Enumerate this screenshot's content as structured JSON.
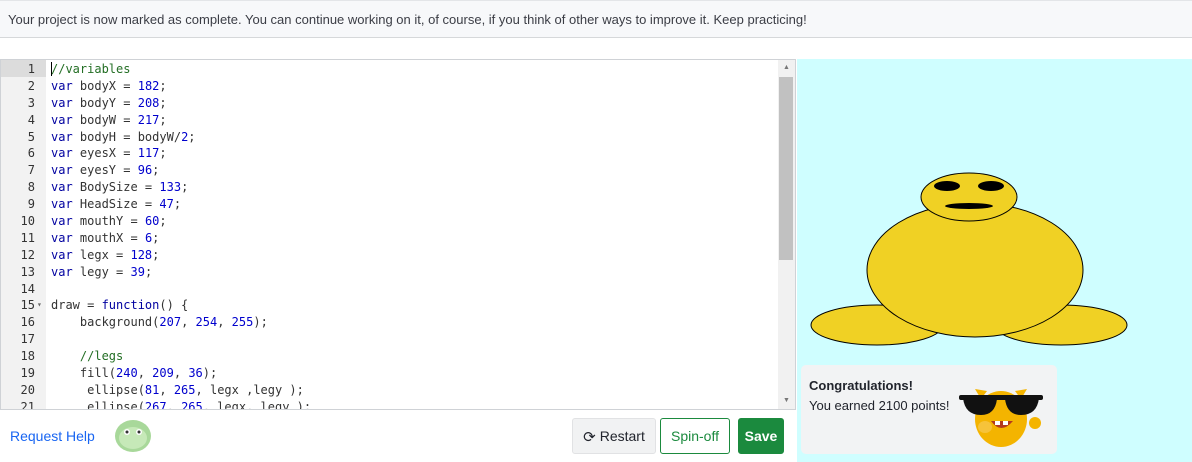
{
  "banner": {
    "message": "Your project is now marked as complete. You can continue working on it, of course, if you think of other ways to improve it. Keep practicing!"
  },
  "editor": {
    "lines": [
      {
        "n": "1",
        "code": "//variables"
      },
      {
        "n": "2",
        "code": "var bodyX = 182;"
      },
      {
        "n": "3",
        "code": "var bodyY = 208;"
      },
      {
        "n": "4",
        "code": "var bodyW = 217;"
      },
      {
        "n": "5",
        "code": "var bodyH = bodyW/2;"
      },
      {
        "n": "6",
        "code": "var eyesX = 117;"
      },
      {
        "n": "7",
        "code": "var eyesY = 96;"
      },
      {
        "n": "8",
        "code": "var BodySize = 133;"
      },
      {
        "n": "9",
        "code": "var HeadSize = 47;"
      },
      {
        "n": "10",
        "code": "var mouthY = 60;"
      },
      {
        "n": "11",
        "code": "var mouthX = 6;"
      },
      {
        "n": "12",
        "code": "var legx = 128;"
      },
      {
        "n": "13",
        "code": "var legy = 39;"
      },
      {
        "n": "14",
        "code": ""
      },
      {
        "n": "15",
        "code": "draw = function() {"
      },
      {
        "n": "16",
        "code": "    background(207, 254, 255);"
      },
      {
        "n": "17",
        "code": ""
      },
      {
        "n": "18",
        "code": "    //legs"
      },
      {
        "n": "19",
        "code": "    fill(240, 209, 36);"
      },
      {
        "n": "20",
        "code": "     ellipse(81, 265, legx ,legy );"
      },
      {
        "n": "21",
        "code": "     ellipse(267, 265, legx, legy );"
      }
    ]
  },
  "congrats": {
    "title": "Congratulations!",
    "points_text": "You earned 2100 points!"
  },
  "footer": {
    "request_help": "Request Help",
    "restart_label": "Restart",
    "spinoff_label": "Spin-off",
    "save_label": "Save"
  },
  "colors": {
    "canvas_bg": "#cffeff",
    "creature_fill": "#f0d124",
    "save_green": "#1b8a3e",
    "link_blue": "#1865f2"
  },
  "icons": [
    "restart-icon",
    "scroll-up-arrow-icon",
    "scroll-down-arrow-icon",
    "fold-arrow-icon"
  ]
}
